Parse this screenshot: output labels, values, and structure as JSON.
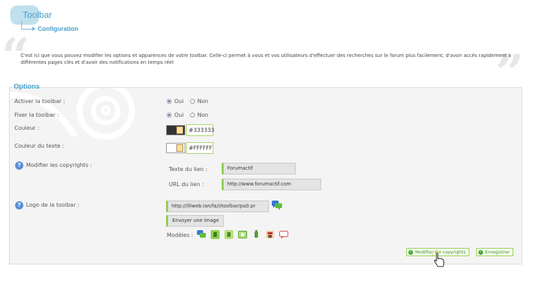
{
  "header": {
    "title": "Toolbar",
    "subtitle": "Configuration"
  },
  "description": "C'est ici que vous pouvez modifier les options et apparences de votre toolbar. Celle-ci permet à vous et vos utilisateurs d'effectuer des recherches sur le forum plus facilement, d'avoir accès rapidement à différentes pages clés et d'avoir des notifications en temps réel",
  "options": {
    "legend": "Options",
    "activate": {
      "label": "Activer la toolbar :",
      "yes": "Oui",
      "no": "Non",
      "selected": "Oui"
    },
    "fix": {
      "label": "Fixer la toolbar :",
      "yes": "Oui",
      "no": "Non",
      "selected": "Oui"
    },
    "color": {
      "label": "Couleur :",
      "value": "#333333",
      "swatch": "#333333"
    },
    "text_color": {
      "label": "Couleur du texte :",
      "value": "#FFFFFF",
      "swatch": "#FFFFFF"
    },
    "copyrights": {
      "label": "Modifier les copyrights :",
      "link_text_label": "Texte du lien :",
      "link_text_value": "Forumactif",
      "link_url_label": "URL du lien :",
      "link_url_value": "http://www.forumactif.com"
    },
    "logo": {
      "label": "Logo de la toolbar :",
      "url_value": "http://illiweb.lan/fa/i/toolbar/pa0.pr",
      "upload_label": "Envoyer une image",
      "models_label": "Modèles :"
    }
  },
  "actions": {
    "modify_copyrights": "Modifier les copyrights",
    "save": "Enregistrer"
  },
  "colors": {
    "accent": "#4aa0c8",
    "green_border": "#8fcf4f",
    "help_icon": "#5c8fd6"
  }
}
